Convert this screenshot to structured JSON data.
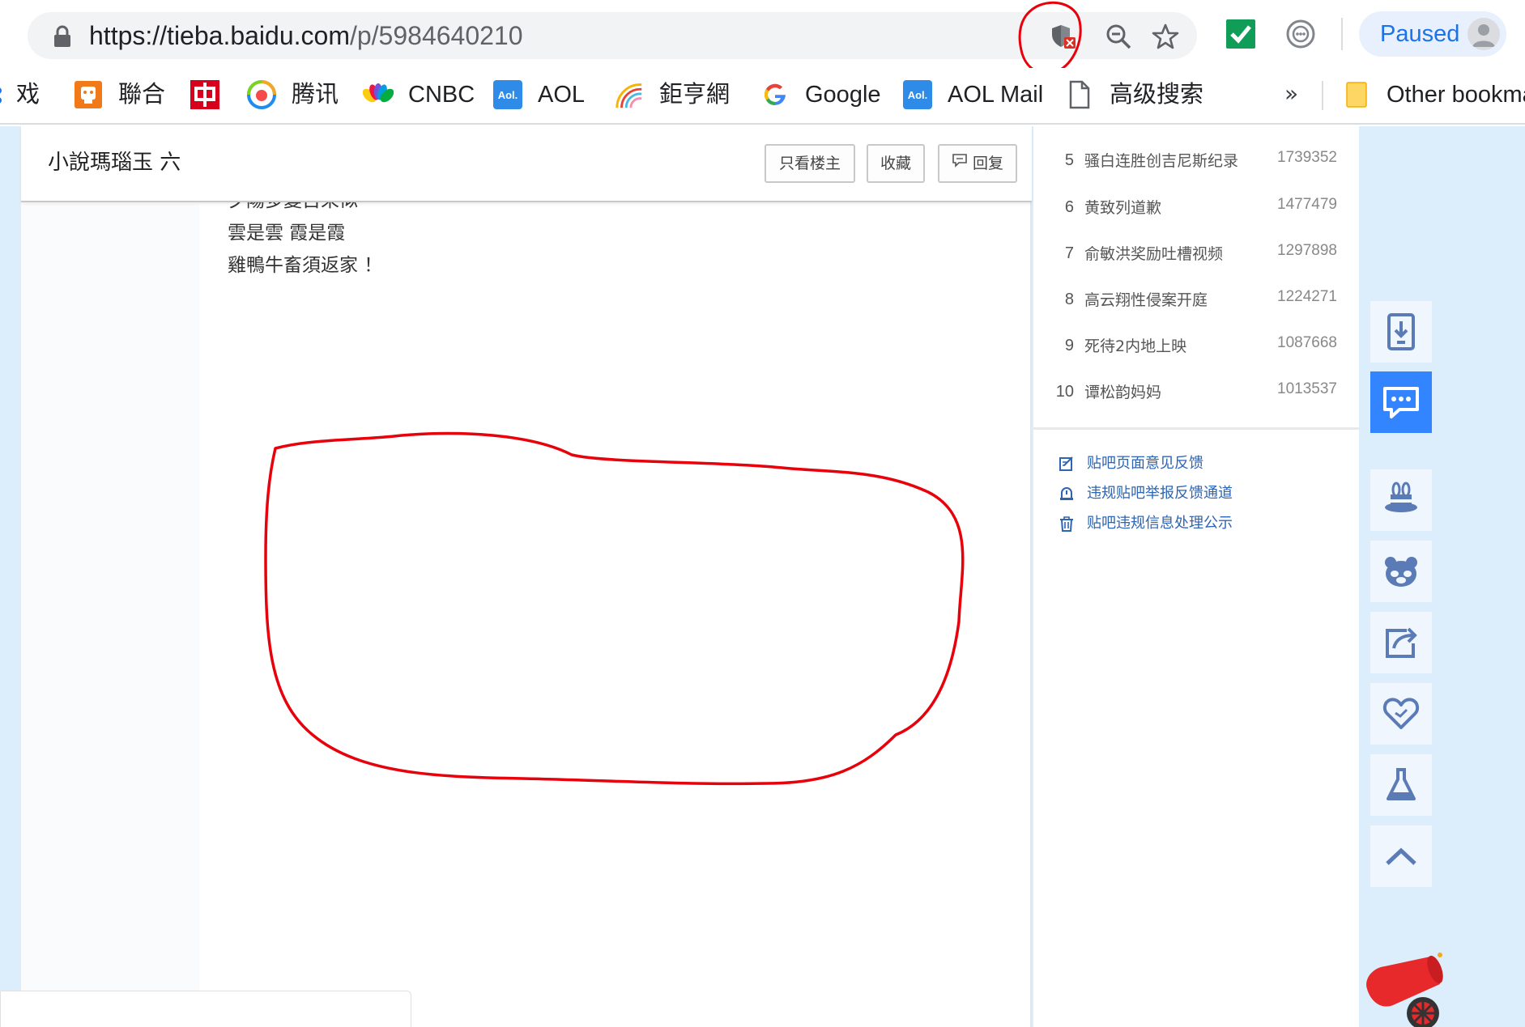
{
  "browser": {
    "url_host": "https://tieba.baidu.com",
    "url_path": "/p/5984640210",
    "profile_status": "Paused",
    "icons": [
      "lock-icon",
      "shield-blocked-icon",
      "zoom-out-icon",
      "star-icon",
      "checkmark-extension-icon",
      "extension-icon",
      "profile-avatar-icon"
    ]
  },
  "bookmarks": {
    "items": [
      {
        "label": "戏",
        "icon": "generic-blue-icon"
      },
      {
        "label": "聯合",
        "icon": "udn-icon"
      },
      {
        "label": "",
        "icon": "chinatimes-icon"
      },
      {
        "label": "腾讯",
        "icon": "tencent-icon"
      },
      {
        "label": "CNBC",
        "icon": "cnbc-peacock-icon"
      },
      {
        "label": "AOL",
        "icon": "aol-icon"
      },
      {
        "label": "鉅亨網",
        "icon": "cnyes-rainbow-icon"
      },
      {
        "label": "Google",
        "icon": "google-icon"
      },
      {
        "label": "AOL Mail",
        "icon": "aol-icon"
      },
      {
        "label": "高级搜索",
        "icon": "page-icon"
      }
    ],
    "more": "»",
    "other": "Other bookma"
  },
  "post": {
    "title": "小說瑪瑙玉 六",
    "buttons": {
      "only_op": "只看楼主",
      "favorite": "收藏",
      "reply": "回复"
    },
    "lines": [
      "夕陽多變古來似",
      "雲是雲 霞是霞",
      "雞鴨牛畜須返家 ！"
    ]
  },
  "hot_list": [
    {
      "rank": "5",
      "title": "骚白连胜创吉尼斯纪录",
      "count": "1739352"
    },
    {
      "rank": "6",
      "title": "黄致列道歉",
      "count": "1477479"
    },
    {
      "rank": "7",
      "title": "俞敏洪奖励吐槽视频",
      "count": "1297898"
    },
    {
      "rank": "8",
      "title": "高云翔性侵案开庭",
      "count": "1224271"
    },
    {
      "rank": "9",
      "title": "死待2内地上映",
      "count": "1087668"
    },
    {
      "rank": "10",
      "title": "谭松韵妈妈",
      "count": "1013537"
    }
  ],
  "feedback_links": [
    {
      "label": "贴吧页面意见反馈",
      "icon": "edit-icon"
    },
    {
      "label": "违规贴吧举报反馈通道",
      "icon": "report-icon"
    },
    {
      "label": "贴吧违规信息处理公示",
      "icon": "trash-icon"
    }
  ],
  "float_tools": [
    "app-download-icon",
    "message-icon",
    "magic-hat-icon",
    "bear-face-icon",
    "share-icon",
    "heart-icon",
    "lab-flask-icon",
    "back-to-top-icon"
  ],
  "colors": {
    "accent": "#3385ff",
    "annotation": "#e8000b",
    "link": "#2d64b3",
    "page_bg": "#dceefc"
  }
}
